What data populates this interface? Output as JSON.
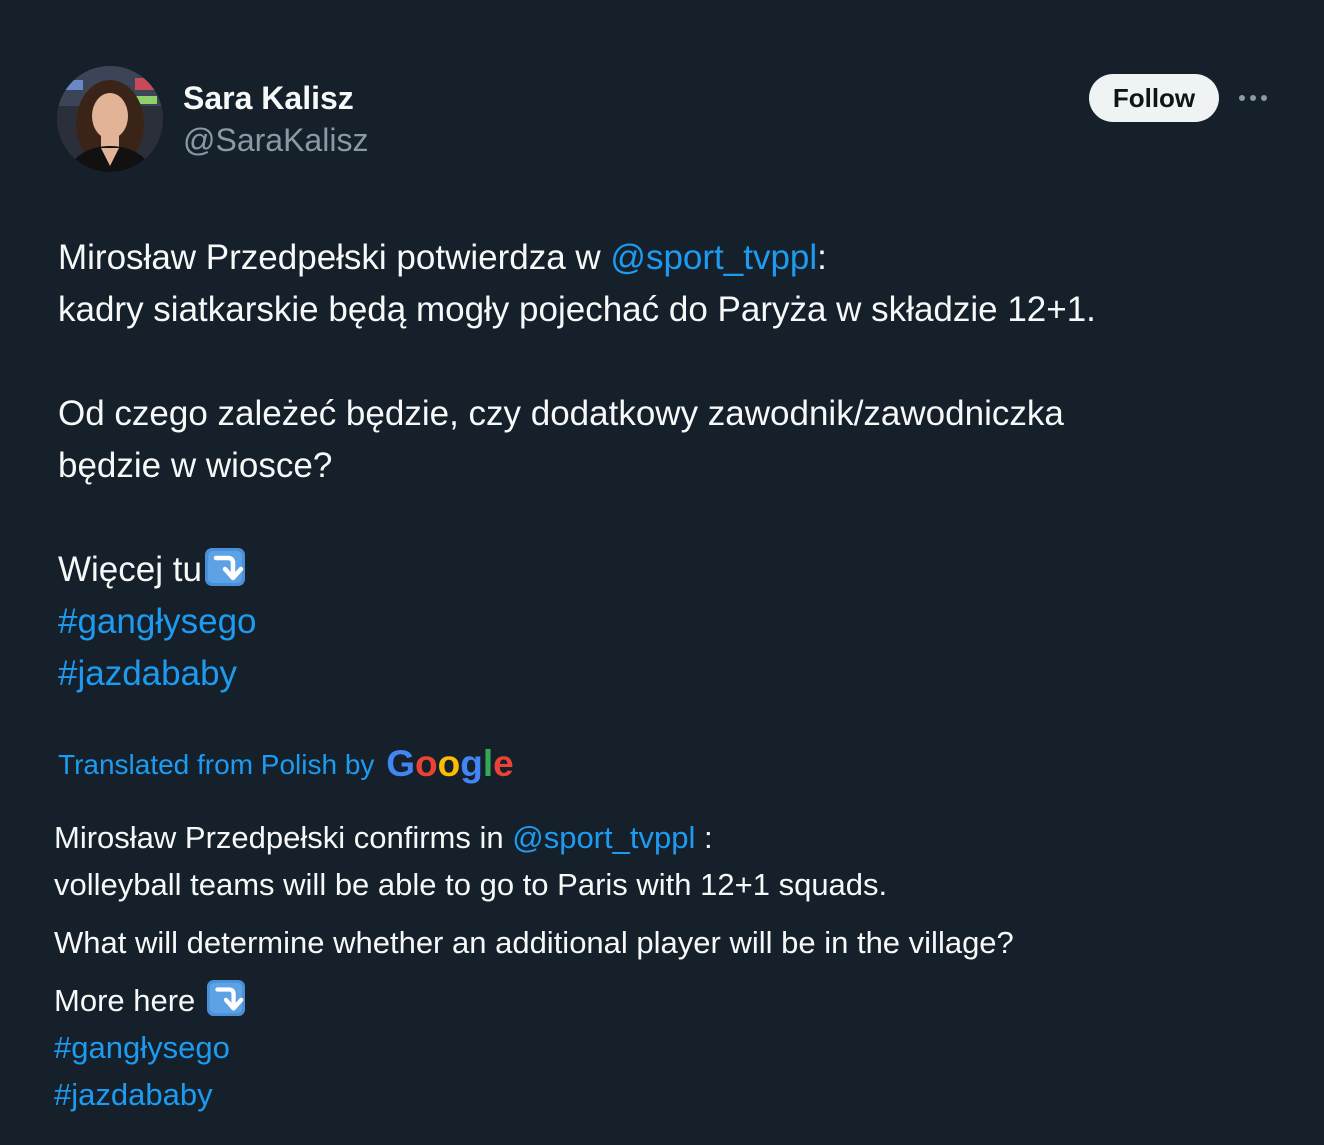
{
  "author": {
    "display_name": "Sara Kalisz",
    "handle": "@SaraKalisz"
  },
  "header": {
    "follow_label": "Follow",
    "more_icon": "more-horizontal-icon"
  },
  "tweet": {
    "line1_prefix": "Mirosław Przedpełski potwierdza w ",
    "line1_mention": "@sport_tvppl",
    "line1_suffix": ":",
    "line2": "kadry siatkarskie będą mogły pojechać do Paryża w składzie 12+1.",
    "line3": "Od czego zależeć będzie, czy dodatkowy zawodnik/zawodniczka",
    "line4": "będzie w wiosce?",
    "line5": "Więcej tu",
    "hashtag1": "#gangłysego",
    "hashtag2": "#jazdababy"
  },
  "translation_banner": {
    "label": "Translated from Polish by ",
    "brand_letters": [
      "G",
      "o",
      "o",
      "g",
      "l",
      "e"
    ],
    "brand_colors": [
      "#4285f4",
      "#ea4335",
      "#fbbc05",
      "#4285f4",
      "#34a853",
      "#ea4335"
    ]
  },
  "translation": {
    "line1_prefix": "Mirosław Przedpełski confirms in ",
    "line1_mention": "@sport_tvppl",
    "line1_suffix": " :",
    "line2": "volleyball teams will be able to go to Paris with 12+1 squads.",
    "line3": "What will determine whether an additional player will be in the village?",
    "line4": "More here ",
    "hashtag1": "#gangłysego",
    "hashtag2": "#jazdababy"
  },
  "colors": {
    "background": "#15202b",
    "text": "#f7f9f9",
    "secondary_text": "#8b98a5",
    "link": "#1d9bf0",
    "emoji_blue": "#4a90d9"
  }
}
